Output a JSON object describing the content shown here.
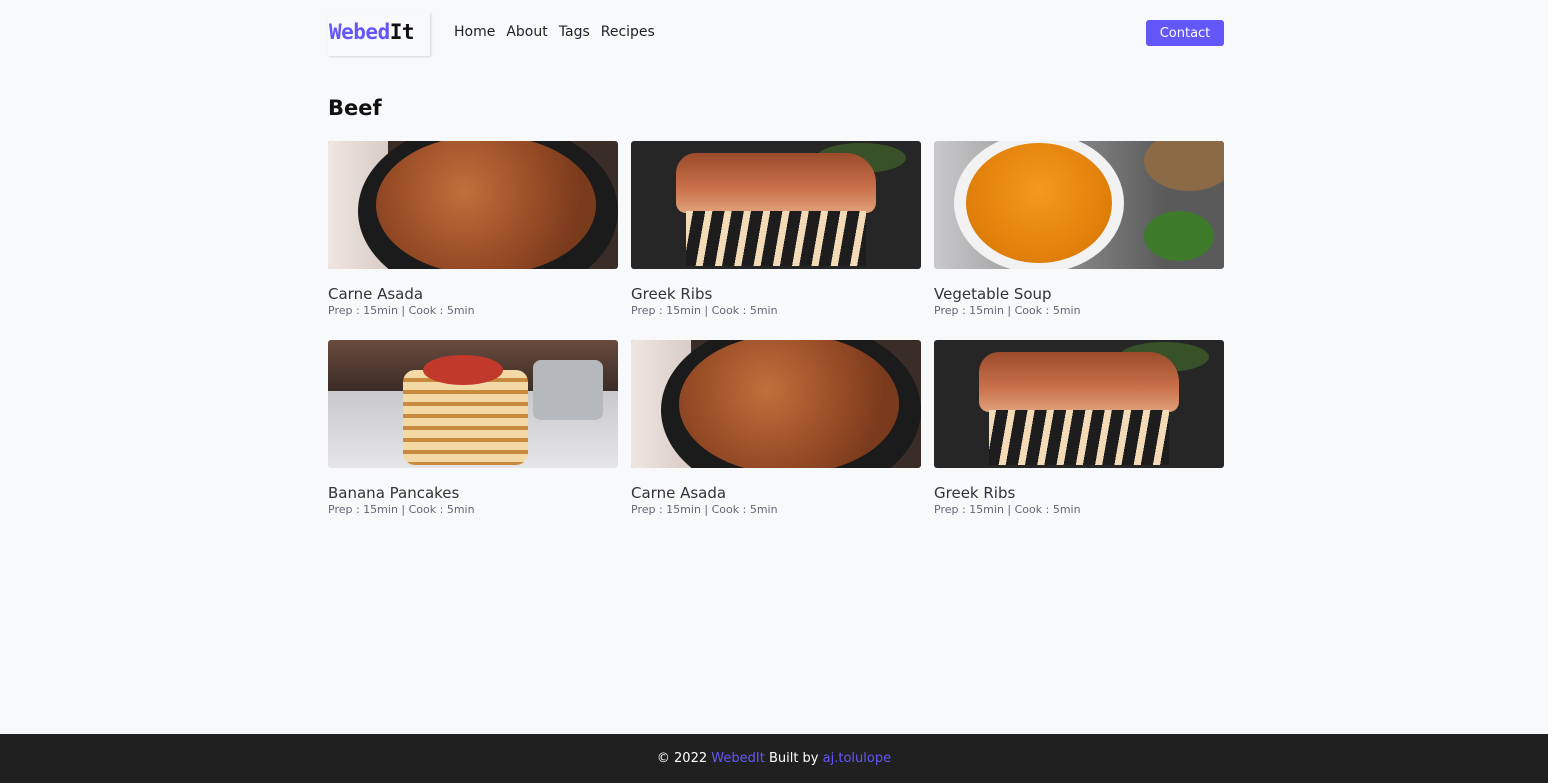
{
  "header": {
    "logo_accent": "Webed",
    "logo_rest": "It",
    "nav": [
      "Home",
      "About",
      "Tags",
      "Recipes"
    ],
    "contact_label": "Contact"
  },
  "page": {
    "title": "Beef"
  },
  "recipes": [
    {
      "title": "Carne Asada",
      "meta": "Prep : 15min | Cook : 5min",
      "image": "carne-asada-photo"
    },
    {
      "title": "Greek Ribs",
      "meta": "Prep : 15min | Cook : 5min",
      "image": "greek-ribs-photo"
    },
    {
      "title": "Vegetable Soup",
      "meta": "Prep : 15min | Cook : 5min",
      "image": "vegetable-soup-photo"
    },
    {
      "title": "Banana Pancakes",
      "meta": "Prep : 15min | Cook : 5min",
      "image": "banana-pancakes-photo"
    },
    {
      "title": "Carne Asada",
      "meta": "Prep : 15min | Cook : 5min",
      "image": "carne-asada-photo"
    },
    {
      "title": "Greek Ribs",
      "meta": "Prep : 15min | Cook : 5min",
      "image": "greek-ribs-photo"
    }
  ],
  "footer": {
    "prefix": "© 2022",
    "brand": "WebedIt",
    "built_by": "Built by",
    "author": "aj.tolulope"
  },
  "colors": {
    "accent": "#6457f9",
    "background": "#f8f9fb",
    "footer_bg": "#202020"
  }
}
